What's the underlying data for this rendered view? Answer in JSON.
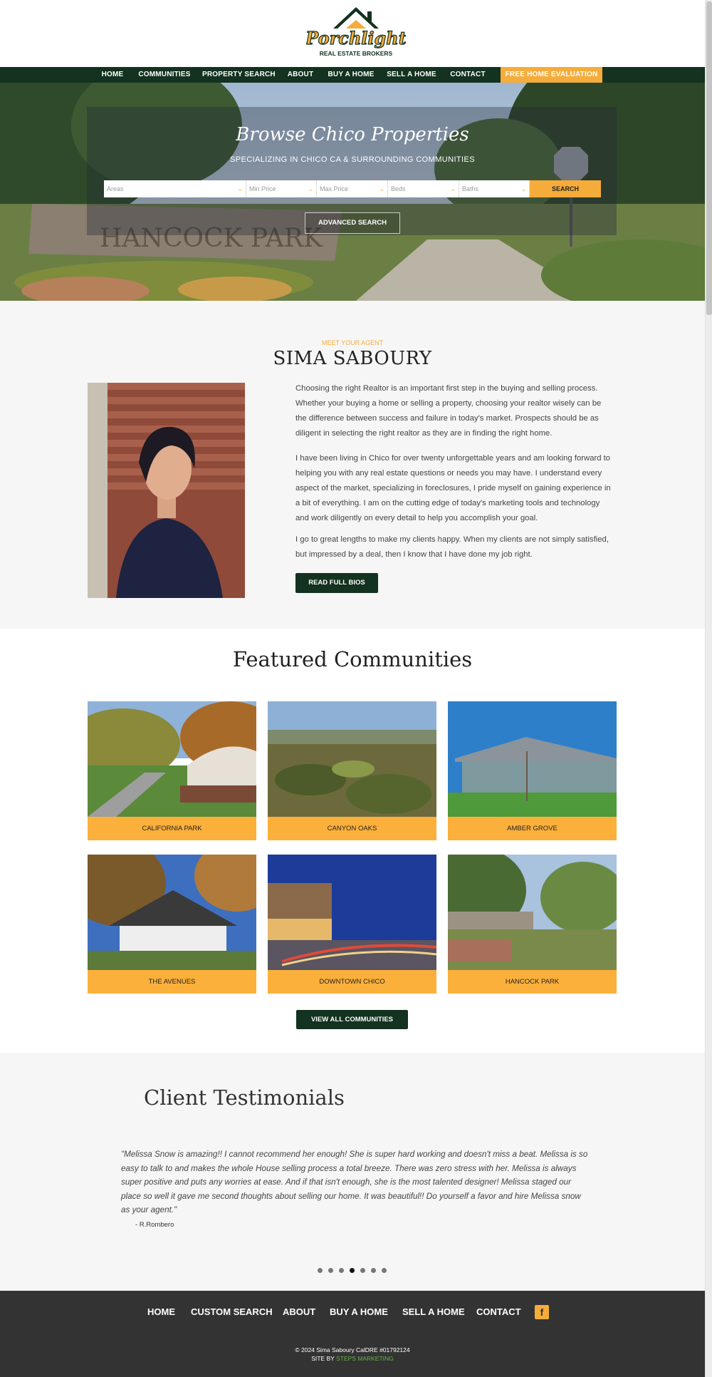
{
  "logo": {
    "name": "Porchlight",
    "tagline": "REAL ESTATE BROKERS"
  },
  "nav": {
    "items": [
      "HOME",
      "COMMUNITIES",
      "PROPERTY SEARCH",
      "ABOUT",
      "BUY A HOME",
      "SELL A HOME",
      "CONTACT"
    ],
    "cta": "FREE HOME EVALUATION"
  },
  "hero": {
    "title": "Browse Chico Properties",
    "subtitle": "SPECIALIZING IN CHICO CA & SURROUNDING COMMUNITIES",
    "selects": [
      "Areas",
      "Min Price",
      "Max Price",
      "Beds",
      "Baths"
    ],
    "search_label": "SEARCH",
    "advanced_label": "ADVANCED SEARCH",
    "sign_text": "HANCOCK PARK"
  },
  "agent": {
    "eyebrow": "MEET YOUR AGENT",
    "name": "SIMA SABOURY",
    "bio": [
      "Choosing the right Realtor is an important first step in the buying and selling process. Whether your buying a home or selling a property, choosing your realtor wisely can be the difference between success and failure in today's market. Prospects should be as diligent in selecting the right realtor as they are in finding the right home.",
      "I have been living in Chico for over twenty unforgettable years and am looking forward to helping you with any real estate questions or needs you may have. I understand every aspect of the market, specializing in foreclosures, I pride myself on gaining experience in a bit of everything. I am on the cutting edge of today's marketing tools and technology and work diligently on every detail to help you accomplish your goal.",
      "I go to great lengths to make my clients happy. When my clients are not simply satisfied, but impressed by a deal, then I know that I have done my job right."
    ],
    "button": "READ FULL BIOS"
  },
  "communities": {
    "title": "Featured Communities",
    "items": [
      "CALIFORNIA PARK",
      "CANYON OAKS",
      "AMBER GROVE",
      "THE AVENUES",
      "DOWNTOWN CHICO",
      "HANCOCK PARK"
    ],
    "button": "VIEW ALL COMMUNITIES"
  },
  "testimonials": {
    "title": "Client Testimonials",
    "quote": "\"Melissa Snow is amazing!! I cannot recommend her enough! She is super hard working and doesn't miss a beat. Melissa is so easy to talk to and makes the whole House selling process a total breeze. There was zero stress with her. Melissa is always super positive and puts any worries at ease. And if that isn't enough, she is the most talented designer! Melissa staged our place so well it gave me second thoughts about selling our home. It was beautiful!! Do yourself a favor and hire Melissa snow as your agent.\"",
    "author": "- R.Rombero",
    "dots_total": 7,
    "dots_active_index": 3
  },
  "footer": {
    "nav": [
      "HOME",
      "CUSTOM SEARCH",
      "ABOUT",
      "BUY A HOME",
      "SELL A HOME",
      "CONTACT"
    ],
    "facebook_icon": "f",
    "copyright": "© 2024 Sima Saboury CalDRE #01792124",
    "credit_prefix": "SITE BY ",
    "credit_link": "STEPS MARKETING"
  },
  "colors": {
    "green": "#133220",
    "orange": "#f6ac3a",
    "light_bg": "#f6f6f6",
    "footer_bg": "#333333"
  }
}
